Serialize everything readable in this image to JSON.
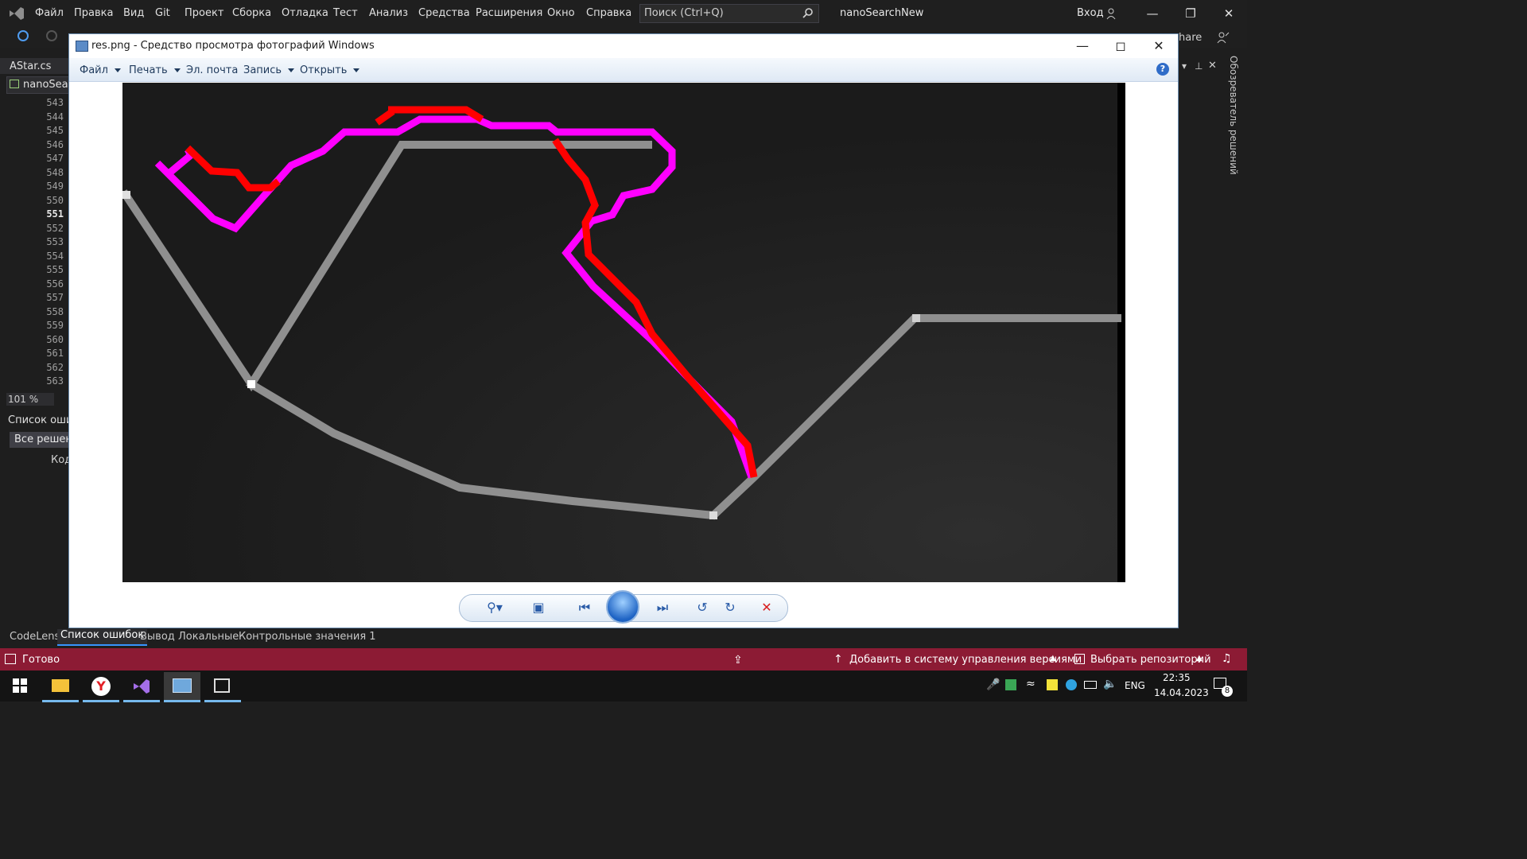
{
  "vs": {
    "menu": [
      "Файл",
      "Правка",
      "Вид",
      "Git",
      "Проект",
      "Сборка",
      "Отладка",
      "Тест",
      "Анализ",
      "Средства",
      "Расширения",
      "Окно",
      "Справка"
    ],
    "search_placeholder": "Поиск (Ctrl+Q)",
    "solution_title": "nanoSearchNew",
    "login": "Вход",
    "share": "hare",
    "editor_tab": "AStar.cs",
    "nav_project": "nanoSearchNew",
    "line_numbers": [
      "543",
      "544",
      "545",
      "546",
      "547",
      "548",
      "549",
      "550",
      "551",
      "552",
      "553",
      "554",
      "555",
      "556",
      "557",
      "558",
      "559",
      "560",
      "561",
      "562",
      "563"
    ],
    "current_line": "551",
    "zoom": "101 %",
    "error_list_title": "Список ошибок",
    "error_list_filter": "Все решения",
    "error_list_col_code": "Код",
    "bottom_tabs": [
      "CodeLens",
      "Список ошибок",
      "Вывод",
      "Локальные",
      "Контрольные значения 1"
    ],
    "solution_explorer": "Обозреватель решений"
  },
  "status": {
    "ready": "Готово",
    "add_vcs": "Добавить в систему управления версиями",
    "select_repo": "Выбрать репозиторий"
  },
  "taskbar": {
    "lang": "ENG",
    "time": "22:35",
    "date": "14.04.2023",
    "notification_count": "8"
  },
  "photo_viewer": {
    "title": "res.png - Средство просмотра фотографий Windows",
    "menu": [
      "Файл",
      "Печать",
      "Эл. почта",
      "Запись",
      "Открыть"
    ],
    "help": "?",
    "image_colors": {
      "background": "#222222",
      "gray_track": "#8a8a8a",
      "magenta_path": "#ff00ff",
      "red_path": "#ff0000"
    }
  }
}
